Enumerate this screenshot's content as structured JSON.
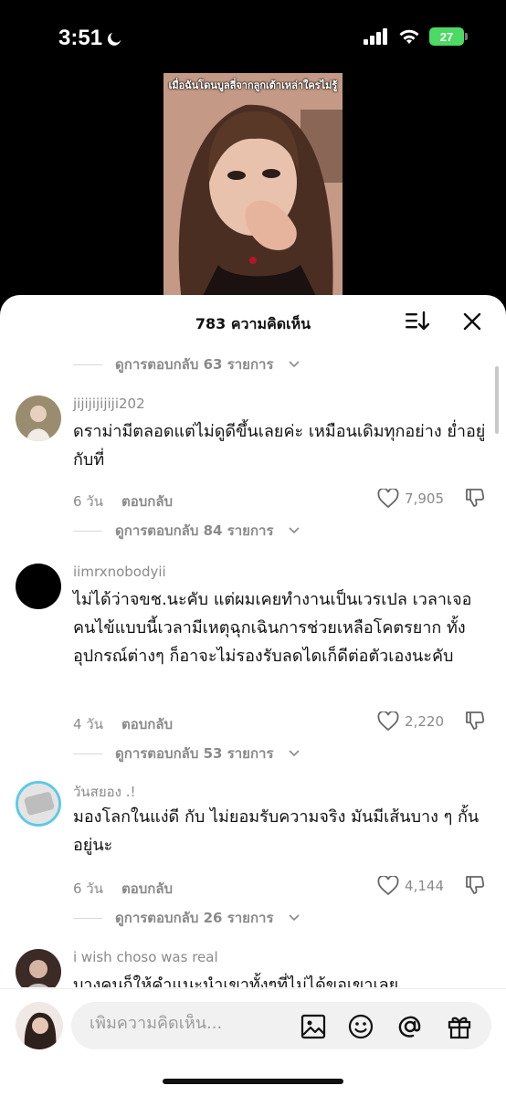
{
  "status_bar": {
    "time": "3:51",
    "battery": "27"
  },
  "video": {
    "caption": "เมื่อฉันโดนบูลลี่จากลูกเต้าเหล่าใครไม่รู้"
  },
  "comments_panel": {
    "title": "783 ความคิดเห็น",
    "reply_threads": [
      "ดูการตอบกลับ 63 รายการ",
      "ดูการตอบกลับ 84 รายการ",
      "ดูการตอบกลับ 53 รายการ",
      "ดูการตอบกลับ 26 รายการ"
    ],
    "comments": [
      {
        "username": "jijijijijiji202",
        "text": "ดราม่ามีตลอดแต่ไม่ดูดีขึ้นเลยค่ะ เหมือนเดิมทุกอย่าง ย่ำอยู่กับที่",
        "time": "6 วัน",
        "reply_label": "ตอบกลับ",
        "likes": "7,905"
      },
      {
        "username": "iimrxnobodyii",
        "text": "ไม่ได้ว่าจขช.นะคับ แต่ผมเคยทำงานเป็นเวรเปล เวลาเจอคนไข้แบบนี้เวลามีเหตุฉุกเฉินการช่วยเหลือโคตรยาก ทั้งอุปกรณ์ต่างๆ ก็อาจะไม่รองรับลดไดเก็ดีต่อตัวเองนะคับ",
        "time": "4 วัน",
        "reply_label": "ตอบกลับ",
        "likes": "2,220"
      },
      {
        "username": "วันสยอง .!",
        "text": "มองโลกในแง่ดี กับ ไม่ยอมรับความจริง มันมีเส้นบาง ๆ กั้นอยู่นะ",
        "time": "6 วัน",
        "reply_label": "ตอบกลับ",
        "likes": "4,144"
      },
      {
        "username": "i wish choso was real",
        "text": "บางคนก็ให้คำแนะนำเขาทั้งๆที่ไม่ได้ขอเขาเลย",
        "time": "",
        "reply_label": "",
        "likes": ""
      }
    ]
  },
  "composer": {
    "placeholder": "เพิ่มความคิดเห็น..."
  },
  "colors": {
    "accent_green": "#4cd964",
    "muted_text": "#8a8a8a",
    "sheet_bg": "#ffffff"
  }
}
